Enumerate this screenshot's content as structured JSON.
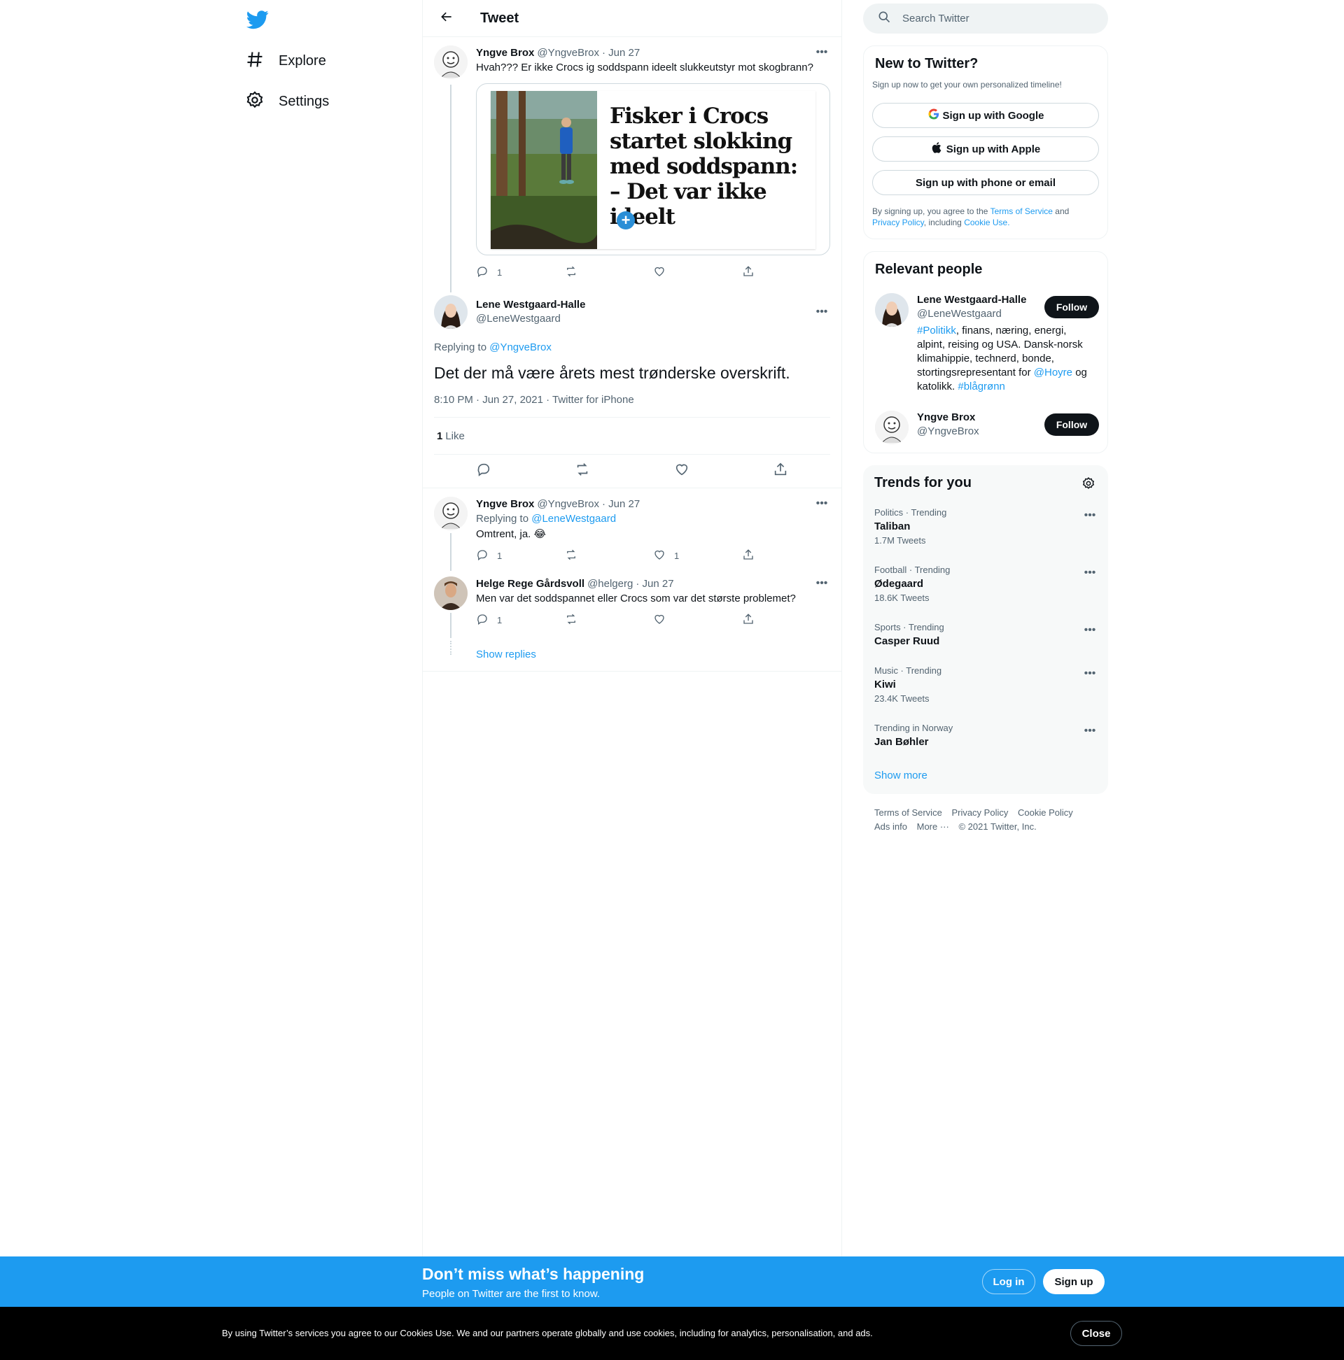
{
  "nav": {
    "items": [
      {
        "label": "Explore",
        "icon": "hashtag-icon"
      },
      {
        "label": "Settings",
        "icon": "gear-icon"
      }
    ]
  },
  "header": {
    "title": "Tweet"
  },
  "thread": {
    "parent": {
      "name": "Yngve Brox",
      "handle": "@YngveBrox",
      "date": "· Jun 27",
      "text": "Hvah??? Er ikke Crocs ig soddspann ideelt slukkeutstyr mot skogbrann?",
      "card_headline": "Fisker i Crocs startet slokking med soddspann: – Det var ikke ideelt",
      "replies": "1",
      "retweets": "",
      "likes": ""
    },
    "focus": {
      "name": "Lene Westgaard-Halle",
      "handle": "@LeneWestgaard",
      "replying_label": "Replying to",
      "replying_to": "@YngveBrox",
      "text": "Det der må være årets mest trønderske overskrift.",
      "meta": "8:10 PM · Jun 27, 2021 · Twitter for iPhone",
      "like_count": "1",
      "like_label": "Like"
    },
    "replies": [
      {
        "name": "Yngve Brox",
        "handle": "@YngveBrox",
        "date": "· Jun 27",
        "replying_label": "Replying to",
        "replying_to": "@LeneWestgaard",
        "text": "Omtrent, ja. 😂",
        "replies": "1",
        "likes": "1"
      },
      {
        "name": "Helge Rege Gårdsvoll",
        "handle": "@helgerg",
        "date": "· Jun 27",
        "text": "Men var det soddspannet eller Crocs som var det største problemet?",
        "replies": "1",
        "likes": ""
      }
    ],
    "show_replies": "Show replies"
  },
  "search": {
    "placeholder": "Search Twitter"
  },
  "new_to_twitter": {
    "title": "New to Twitter?",
    "subtitle": "Sign up now to get your own personalized timeline!",
    "google": "Sign up with Google",
    "apple": "Sign up with Apple",
    "phone": "Sign up with phone or email",
    "legal_pre": "By signing up, you agree to the",
    "tos": "Terms of Service",
    "and": "and",
    "privacy": "Privacy Policy",
    "including": ", including",
    "cookie": "Cookie Use."
  },
  "relevant": {
    "title": "Relevant people",
    "follow_label": "Follow",
    "people": [
      {
        "name": "Lene Westgaard-Halle",
        "handle": "@LeneWestgaard",
        "bio_tag1": "#Politikk",
        "bio_mid": ", finans, næring, energi, alpint, reising og USA. Dansk-norsk klimahippie, technerd, bonde, stortingsrepresentant for",
        "bio_mention": "@Hoyre",
        "bio_og": "og katolikk.",
        "bio_tag2": "#blågrønn"
      },
      {
        "name": "Yngve Brox",
        "handle": "@YngveBrox"
      }
    ]
  },
  "trends": {
    "title": "Trends for you",
    "items": [
      {
        "category": "Politics · Trending",
        "name": "Taliban",
        "count": "1.7M Tweets"
      },
      {
        "category": "Football · Trending",
        "name": "Ødegaard",
        "count": "18.6K Tweets"
      },
      {
        "category": "Sports · Trending",
        "name": "Casper Ruud",
        "count": ""
      },
      {
        "category": "Music · Trending",
        "name": "Kiwi",
        "count": "23.4K Tweets"
      },
      {
        "category": "Trending in Norway",
        "name": "Jan Bøhler",
        "count": ""
      }
    ],
    "show_more": "Show more"
  },
  "footer": {
    "tos": "Terms of Service",
    "privacy": "Privacy Policy",
    "cookie": "Cookie Policy",
    "ads": "Ads info",
    "more": "More ···",
    "copyright": "© 2021 Twitter, Inc."
  },
  "bottom_bar": {
    "title": "Don’t miss what’s happening",
    "subtitle": "People on Twitter are the first to know.",
    "login": "Log in",
    "signup": "Sign up"
  },
  "cookie_bar": {
    "text": "By using Twitter’s services you agree to our Cookies Use. We and our partners operate globally and use cookies, including for analytics, personalisation, and ads.",
    "close": "Close"
  },
  "colors": {
    "accent": "#1d9bf0",
    "text": "#0f1419",
    "muted": "#536471",
    "border": "#eff3f4"
  }
}
